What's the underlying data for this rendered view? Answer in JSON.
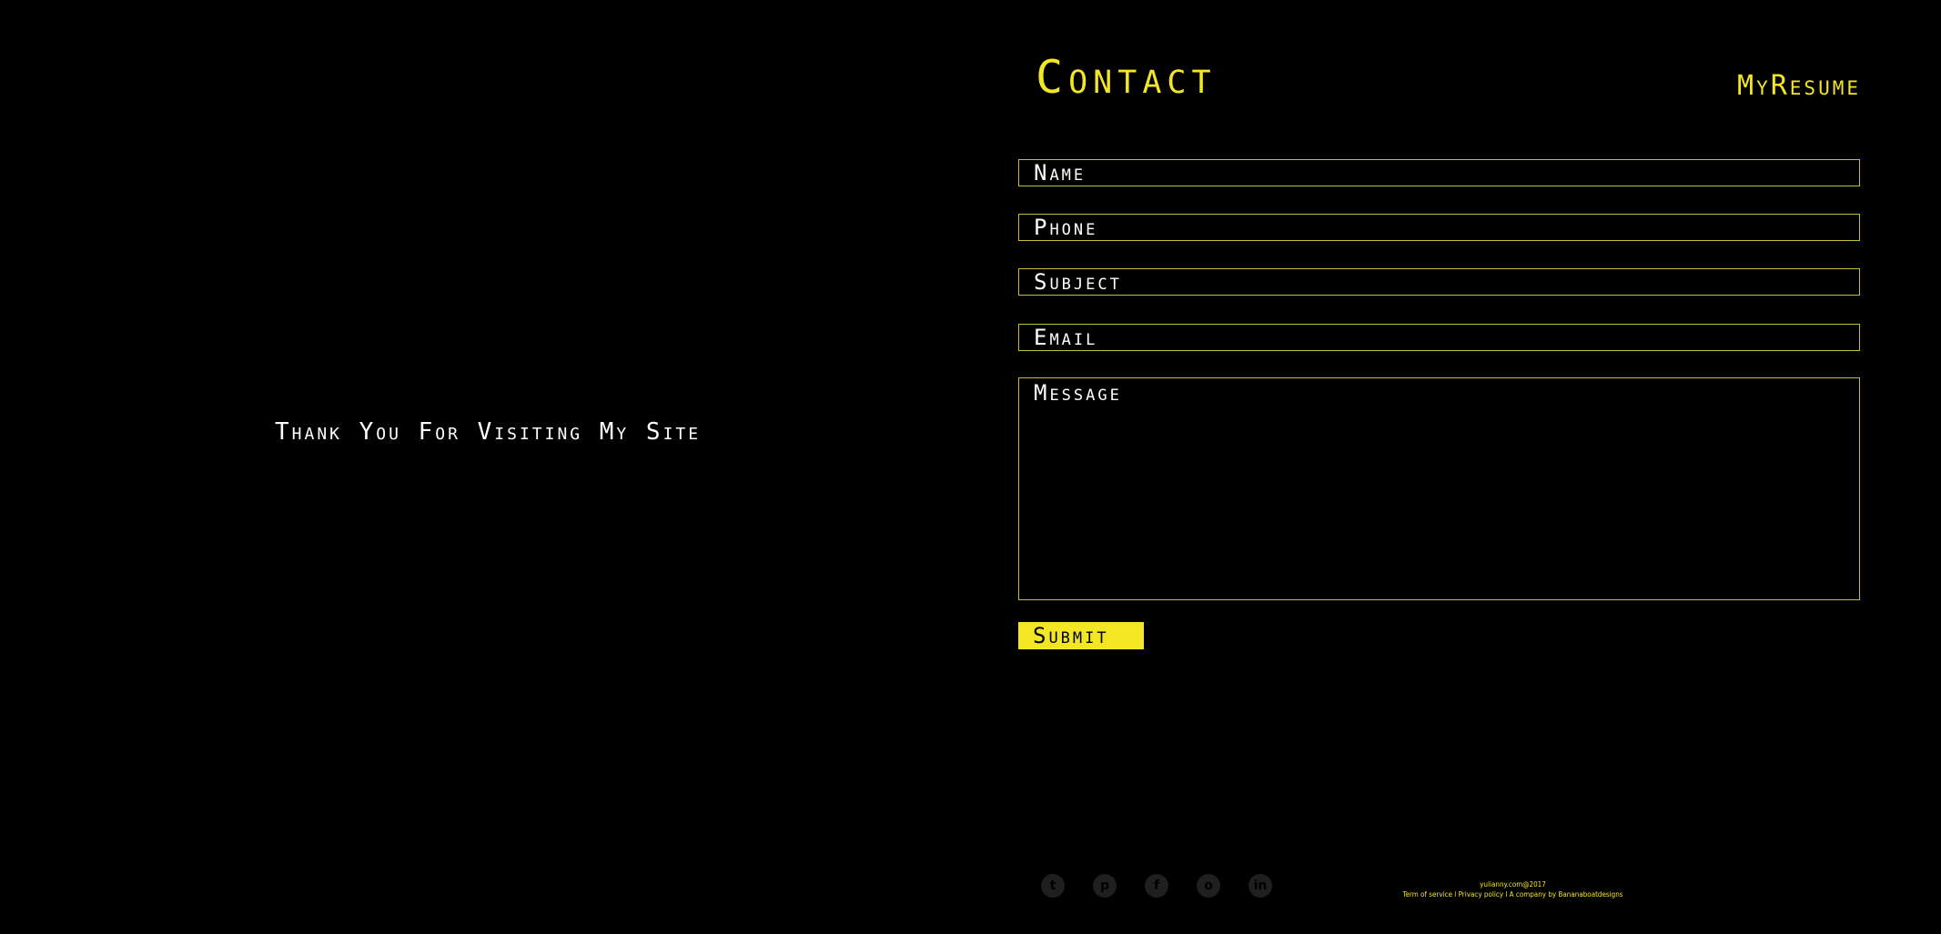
{
  "left_panel": {
    "message": "Thank You For Visiting My Site"
  },
  "header": {
    "title": "Contact",
    "brand": "MyResume"
  },
  "form": {
    "name_placeholder": "Name",
    "phone_placeholder": "Phone",
    "subject_placeholder": "Subject",
    "email_placeholder": "Email",
    "message_placeholder": "Message",
    "submit_label": "Submit"
  },
  "social": {
    "icons": [
      "twitter-icon",
      "pinterest-icon",
      "facebook-icon",
      "instagram-icon",
      "linkedin-icon"
    ],
    "glyphs": [
      "t",
      "p",
      "f",
      "o",
      "in"
    ]
  },
  "footer": {
    "copyright": "yulianny.com@2017",
    "links": "Term of service l Privacy policy l A company by Bananaboatdesigns"
  },
  "colors": {
    "background": "#000000",
    "accent": "#f3e624",
    "field_border": "#c8bd35",
    "text": "#ffffff"
  }
}
